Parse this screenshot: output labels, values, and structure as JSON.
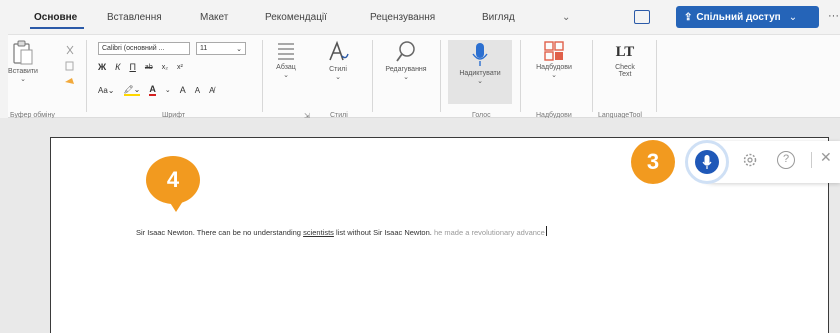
{
  "tabs": [
    {
      "label": "Основне",
      "active": true
    },
    {
      "label": "Вставлення"
    },
    {
      "label": "Макет"
    },
    {
      "label": "Рекомендації"
    },
    {
      "label": "Рецензування"
    },
    {
      "label": "Вигляд"
    }
  ],
  "share_button": {
    "label": "Спільний доступ"
  },
  "ribbon": {
    "clipboard": {
      "paste_label": "Вставити",
      "group_label": "Буфер обміну"
    },
    "font": {
      "font_name": "Calibri (основний ...",
      "font_size": "11",
      "bold": "Ж",
      "italic": "К",
      "underline": "П",
      "strike": "ab",
      "subscript": "x₂",
      "superscript": "x²",
      "group_label": "Шрифт"
    },
    "paragraph": {
      "label": "Абзац"
    },
    "styles": {
      "label": "Стилі",
      "group_label": "Стилі"
    },
    "editing": {
      "label": "Редагування"
    },
    "voice": {
      "label": "Надиктувати",
      "group_label": "Голос"
    },
    "designer": {
      "label": "Надбудови",
      "group_label": "Надбудови"
    },
    "check": {
      "label_line1": "Check",
      "label_line2": "Text",
      "group_label": "LanguageTool"
    }
  },
  "document": {
    "text_main": "Sir Isaac Newton. There can be no understanding ",
    "text_underlined": "scientists",
    "text_after": " list without Sir Isaac Newton. ",
    "text_suggestion": "he made a revolutionary advance"
  },
  "callouts": {
    "badge3": "3",
    "badge4": "4"
  },
  "colors": {
    "accent": "#2564b8",
    "callout": "#f29a1f",
    "mic": "#1f58b8"
  },
  "icons": {
    "dictation_mic": "microphone-icon",
    "settings": "gear-icon",
    "help": "help-icon",
    "close": "close-icon"
  }
}
